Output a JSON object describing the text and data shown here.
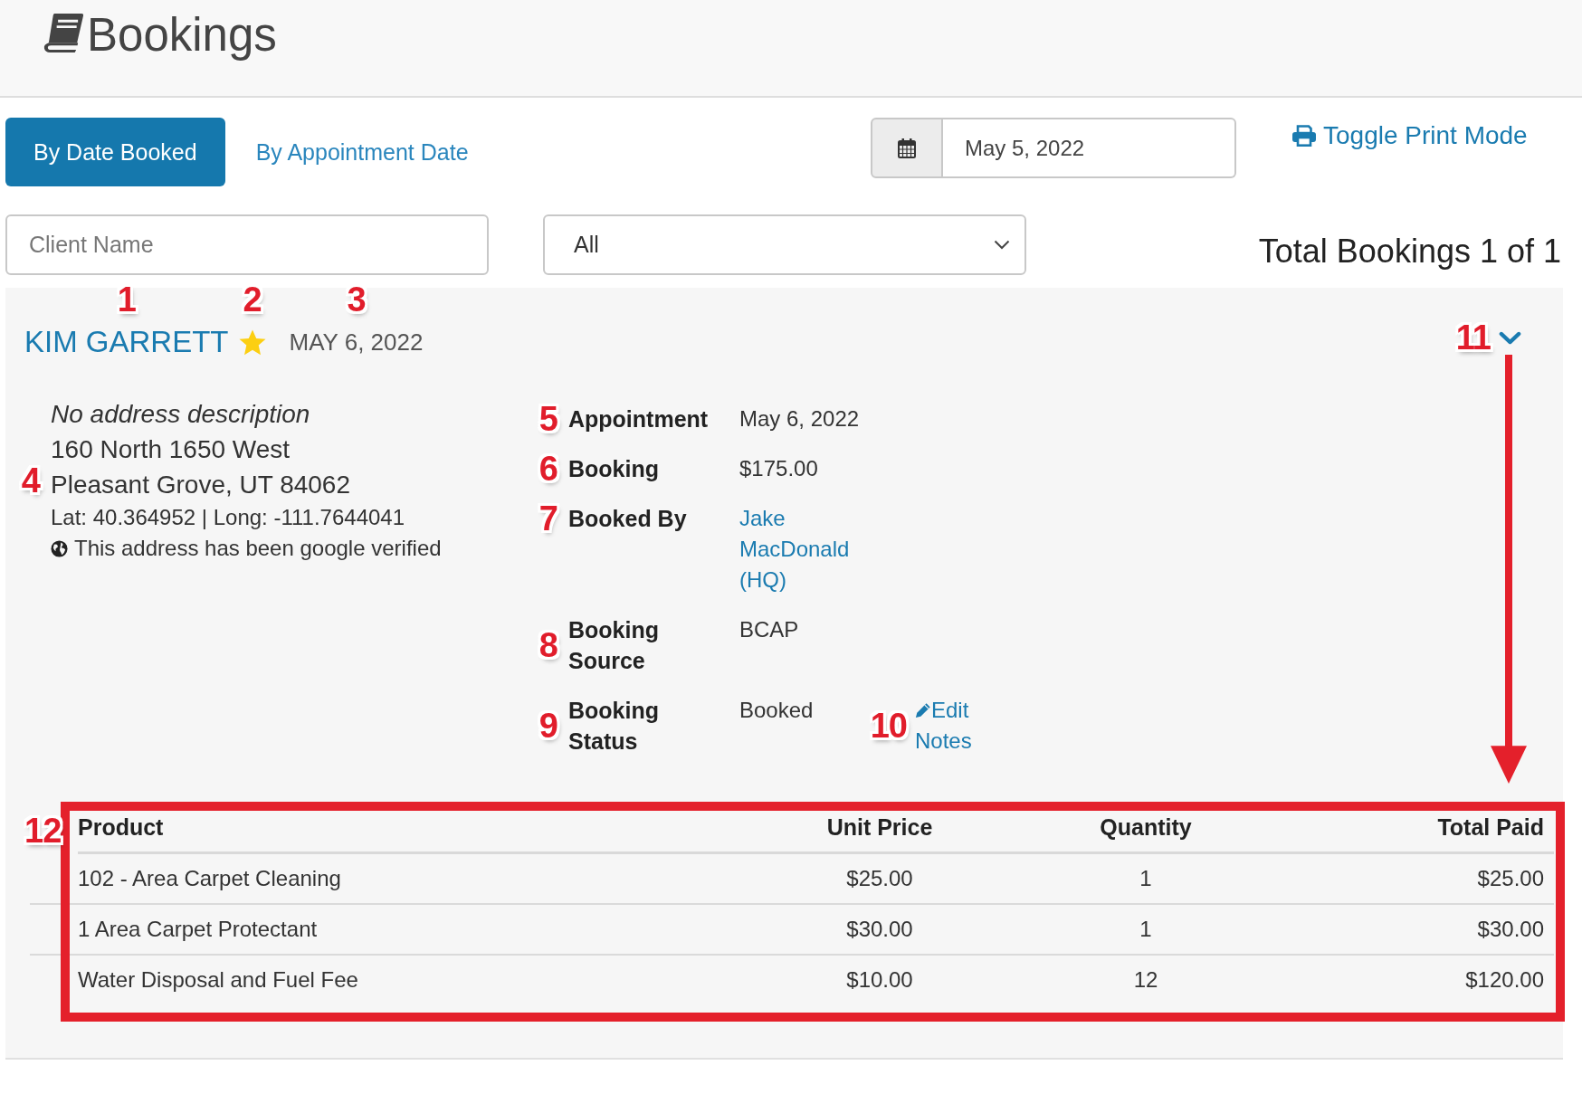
{
  "header": {
    "title": "Bookings"
  },
  "tabs": [
    {
      "label": "By Date Booked",
      "selected": true
    },
    {
      "label": "By Appointment Date",
      "selected": false
    }
  ],
  "date_filter": {
    "value": "May 5, 2022"
  },
  "print_link": {
    "label": "Toggle Print Mode"
  },
  "client_search": {
    "placeholder": "Client Name"
  },
  "status_filter": {
    "value": "All"
  },
  "total": "Total Bookings 1 of 1",
  "booking": {
    "client_name": "KIM GARRETT",
    "client_name_callout": "1",
    "starred": true,
    "star_callout": "2",
    "date": "MAY 6, 2022",
    "date_callout": "3",
    "toggle_callout": "11",
    "address": {
      "callout": "4",
      "description": "No address description",
      "lines": [
        "160 North 1650 West",
        "Pleasant Grove, UT 84062"
      ],
      "coordinates": "Lat: 40.364952 | Long: -111.7644041",
      "verified_note": "This address has been google verified"
    },
    "details": [
      {
        "callout": "5",
        "label": "Appointment",
        "value": "May 6, 2022",
        "kind": "text"
      },
      {
        "callout": "6",
        "label": "Booking",
        "value": "$175.00",
        "kind": "text"
      },
      {
        "callout": "7",
        "label": "Booked By",
        "value": "Jake MacDonald (HQ)",
        "kind": "link"
      },
      {
        "callout": "8",
        "label": "Booking Source",
        "value": "BCAP",
        "kind": "text"
      },
      {
        "callout": "9",
        "label": "Booking Status",
        "value": "Booked",
        "kind": "text",
        "action": {
          "label": "Edit Notes",
          "callout": "10"
        }
      }
    ],
    "products": {
      "callout": "12",
      "highlighted": true,
      "pointer_arrow": true,
      "columns": [
        "Product",
        "Unit Price",
        "Quantity",
        "Total Paid"
      ],
      "rows": [
        [
          "102 - Area Carpet Cleaning",
          "$25.00",
          "1",
          "$25.00"
        ],
        [
          "1 Area Carpet Protectant",
          "$30.00",
          "1",
          "$30.00"
        ],
        [
          "Water Disposal and Fuel Fee",
          "$10.00",
          "12",
          "$120.00"
        ]
      ]
    }
  }
}
